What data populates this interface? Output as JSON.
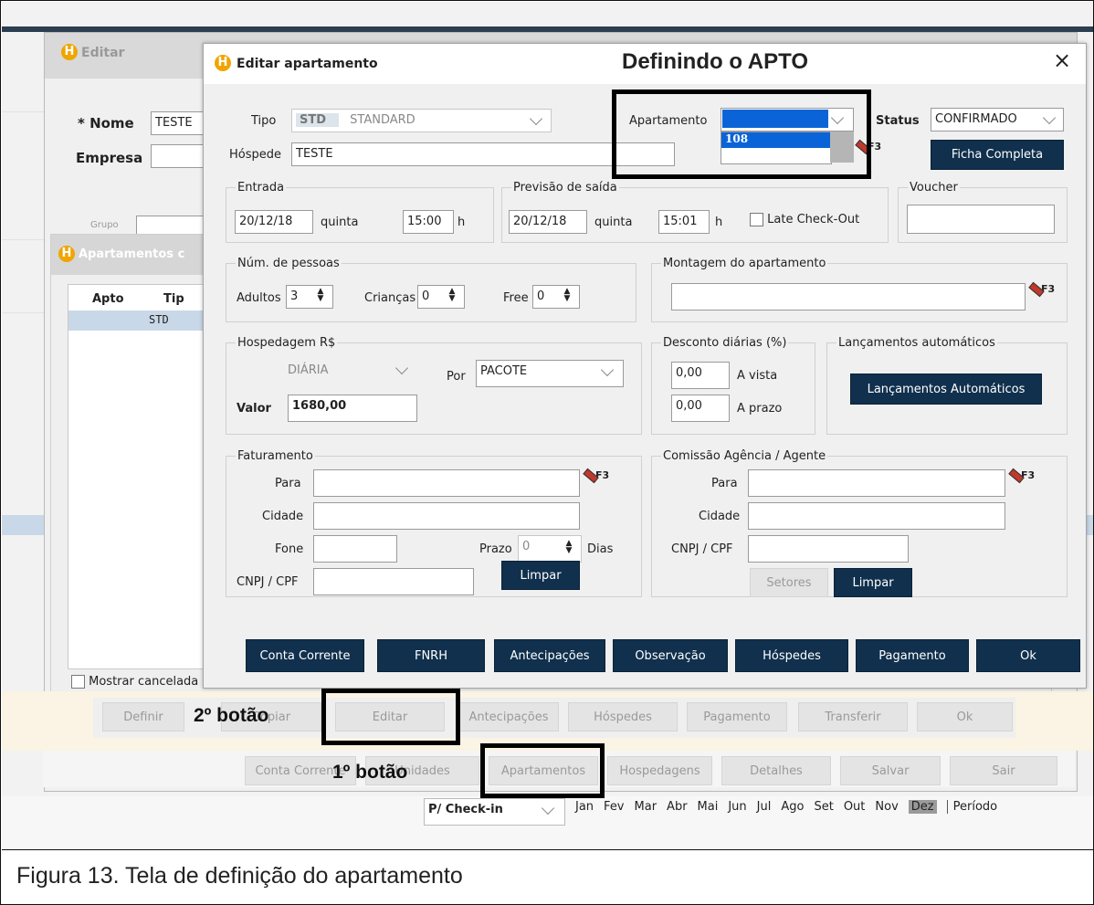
{
  "caption": "Figura 13. Tela de definição do apartamento",
  "background": {
    "editar_title": "Editar",
    "nome_label": "* Nome",
    "nome_value": "TESTE",
    "empresa_label": "Empresa",
    "apartamentos_title": "Apartamentos c",
    "col_apto": "Apto",
    "col_tipo": "Tip",
    "row_tipo": "STD",
    "mostrar_cancelada": "Mostrar cancelada",
    "grupo_label": "Grupo",
    "buttons_row1": [
      "Definir",
      "Copiar",
      "Editar",
      "Antecipações",
      "Hóspedes",
      "Pagamento",
      "Transferir",
      "Ok"
    ],
    "buttons_row2": [
      "Conta Corrente",
      "Unidades",
      "Apartamentos",
      "Hospedagens",
      "Detalhes",
      "Salvar",
      "Sair"
    ],
    "checkin_select": "P/ Check-in",
    "months": [
      "Jan",
      "Fev",
      "Mar",
      "Abr",
      "Mai",
      "Jun",
      "Jul",
      "Ago",
      "Set",
      "Out",
      "Nov",
      "Dez"
    ],
    "selected_month": "Dez",
    "periodo": "Período"
  },
  "annotations": {
    "heading": "Definindo o APTO",
    "first_button": "1º botão",
    "second_button": "2º botão"
  },
  "dialog": {
    "title": "Editar apartamento",
    "close_glyph": "×",
    "tipo_label": "Tipo",
    "tipo_code": "STD",
    "tipo_name": "STANDARD",
    "apartamento_label": "Apartamento",
    "apartamento_option": "108",
    "status_label": "Status",
    "status_value": "CONFIRMADO",
    "hospede_label": "Hóspede",
    "hospede_value": "TESTE",
    "ficha_completa": "Ficha Completa",
    "entrada": {
      "legend": "Entrada",
      "date": "20/12/18",
      "weekday": "quinta",
      "time": "15:00",
      "h": "h"
    },
    "previsao": {
      "legend": "Previsão de saída",
      "date": "20/12/18",
      "weekday": "quinta",
      "time": "15:01",
      "h": "h",
      "late_checkout": "Late Check-Out"
    },
    "voucher": {
      "legend": "Voucher",
      "value": ""
    },
    "pessoas": {
      "legend": "Núm. de pessoas",
      "adultos_label": "Adultos",
      "adultos": "3",
      "criancas_label": "Crianças",
      "criancas": "0",
      "free_label": "Free",
      "free": "0"
    },
    "montagem": {
      "legend": "Montagem do apartamento",
      "value": ""
    },
    "hospedagem": {
      "legend": "Hospedagem R$",
      "diaria": "DIÁRIA",
      "por_label": "Por",
      "por_value": "PACOTE",
      "valor_label": "Valor",
      "valor": "1680,00"
    },
    "desconto": {
      "legend": "Desconto diárias (%)",
      "avista": "0,00",
      "avista_label": "A vista",
      "aprazo": "0,00",
      "aprazo_label": "A prazo"
    },
    "lancamentos": {
      "legend": "Lançamentos automáticos",
      "button": "Lançamentos Automáticos"
    },
    "faturamento": {
      "legend": "Faturamento",
      "para_label": "Para",
      "cidade_label": "Cidade",
      "fone_label": "Fone",
      "prazo_label": "Prazo",
      "prazo": "0",
      "dias_label": "Dias",
      "cnpj_label": "CNPJ / CPF",
      "limpar": "Limpar"
    },
    "comissao": {
      "legend": "Comissão Agência / Agente",
      "para_label": "Para",
      "cidade_label": "Cidade",
      "cnpj_label": "CNPJ / CPF",
      "setores": "Setores",
      "limpar": "Limpar"
    },
    "f3": "F3",
    "footer_buttons": [
      "Conta Corrente",
      "FNRH",
      "Antecipações",
      "Observação",
      "Hóspedes",
      "Pagamento",
      "Ok"
    ]
  }
}
